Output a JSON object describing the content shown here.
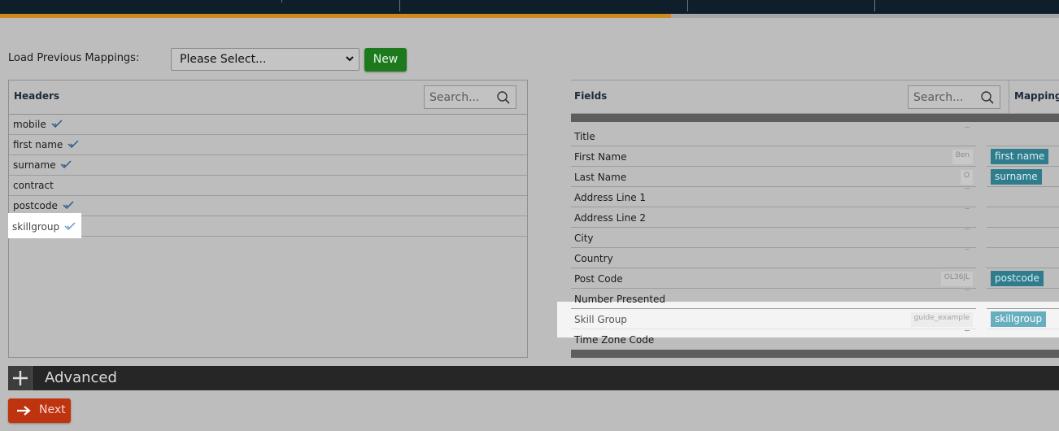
{
  "progress": {
    "fraction": 0.634,
    "accent": "#cf8a1e"
  },
  "load_mappings": {
    "label": "Load Previous Mappings:",
    "select_value": "Please Select...",
    "new_label": "New"
  },
  "headers_panel": {
    "title": "Headers",
    "search_placeholder": "Search...",
    "items": [
      {
        "label": "mobile",
        "checked": true
      },
      {
        "label": "first name",
        "checked": true
      },
      {
        "label": "surname",
        "checked": true
      },
      {
        "label": "contract",
        "checked": false
      },
      {
        "label": "postcode",
        "checked": true
      },
      {
        "label": "skillgroup",
        "checked": true
      }
    ]
  },
  "fields_panel": {
    "title": "Fields",
    "search_placeholder": "Search...",
    "mapping_header": "Mapping",
    "rows": [
      {
        "label": "Title",
        "sample": "",
        "mapping": ""
      },
      {
        "label": "First Name",
        "sample": "Ben",
        "mapping": "first name"
      },
      {
        "label": "Last Name",
        "sample": "O",
        "mapping": "surname"
      },
      {
        "label": "Address Line 1",
        "sample": "",
        "mapping": ""
      },
      {
        "label": "Address Line 2",
        "sample": "",
        "mapping": ""
      },
      {
        "label": "City",
        "sample": "",
        "mapping": ""
      },
      {
        "label": "Country",
        "sample": "",
        "mapping": ""
      },
      {
        "label": "Post Code",
        "sample": "OL36JL",
        "mapping": "postcode"
      },
      {
        "label": "Number Presented",
        "sample": "",
        "mapping": ""
      },
      {
        "label": "Skill Group",
        "sample": "guide_example",
        "mapping": "skillgroup"
      },
      {
        "label": "Time Zone Code",
        "sample": "",
        "mapping": ""
      }
    ]
  },
  "advanced": {
    "label": "Advanced"
  },
  "next_button": {
    "label": "Next"
  },
  "colors": {
    "new_green": "#1c7a1c",
    "next_red": "#c0330f",
    "mapping_teal": "#2f7d8c"
  },
  "icons": [
    "search-icon",
    "check-icon",
    "plus-icon",
    "arrow-right-icon",
    "chevron-down-icon"
  ]
}
